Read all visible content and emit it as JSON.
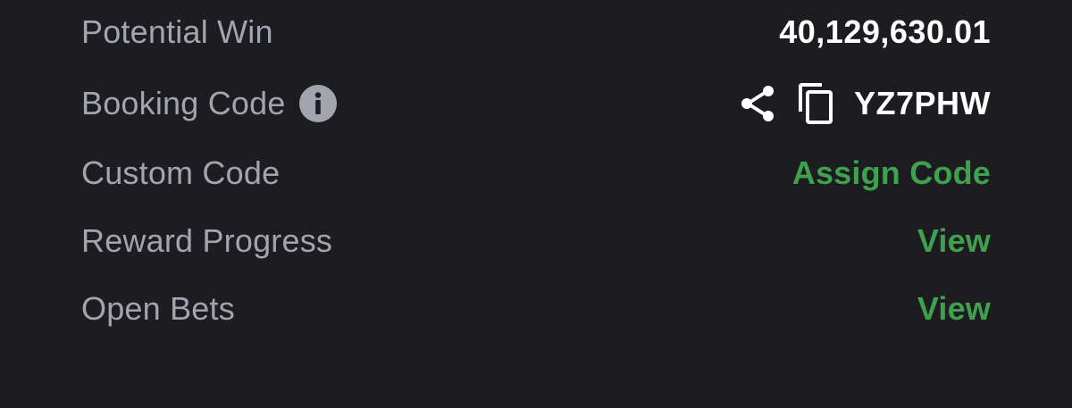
{
  "rows": {
    "potential_win": {
      "label": "Potential Win",
      "value": "40,129,630.01"
    },
    "booking_code": {
      "label": "Booking Code",
      "value": "YZ7PHW",
      "info_icon": "info-icon",
      "share_icon": "share-icon",
      "copy_icon": "copy-icon"
    },
    "custom_code": {
      "label": "Custom Code",
      "action": "Assign Code"
    },
    "reward_progress": {
      "label": "Reward Progress",
      "action": "View"
    },
    "open_bets": {
      "label": "Open Bets",
      "action": "View"
    }
  },
  "colors": {
    "background": "#1c1c21",
    "label": "#a2a4ae",
    "value": "#ffffff",
    "accent_green": "#3fa04d"
  }
}
